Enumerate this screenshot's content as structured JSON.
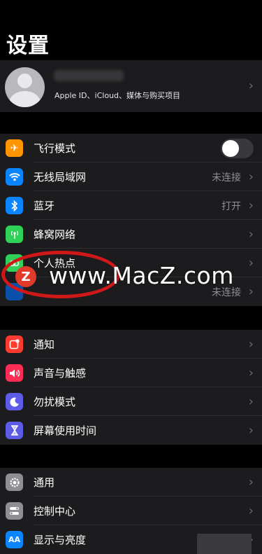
{
  "header": {
    "title": "设置"
  },
  "profile": {
    "subtitle": "Apple ID、iCloud、媒体与购买项目"
  },
  "group1": [
    {
      "label": "飞行模式",
      "icon": "airplane-icon",
      "color": "#ff9500",
      "toggle": false
    },
    {
      "label": "无线局域网",
      "icon": "wifi-icon",
      "color": "#0a84ff",
      "value": "未连接"
    },
    {
      "label": "蓝牙",
      "icon": "bluetooth-icon",
      "color": "#0a84ff",
      "value": "打开"
    },
    {
      "label": "蜂窝网络",
      "icon": "cellular-icon",
      "color": "#30d158"
    },
    {
      "label": "个人热点",
      "icon": "hotspot-icon",
      "color": "#30d158"
    },
    {
      "label": "",
      "icon": "vpn-icon",
      "color": "#0a4fa8",
      "value": "未连接"
    }
  ],
  "group2": [
    {
      "label": "通知",
      "icon": "notifications-icon",
      "color": "#ff3b30"
    },
    {
      "label": "声音与触感",
      "icon": "sounds-icon",
      "color": "#ff2d55"
    },
    {
      "label": "勿扰模式",
      "icon": "moon-icon",
      "color": "#5e5ce6"
    },
    {
      "label": "屏幕使用时间",
      "icon": "hourglass-icon",
      "color": "#5e5ce6"
    }
  ],
  "group3": [
    {
      "label": "通用",
      "icon": "gear-icon",
      "color": "#8e8e93"
    },
    {
      "label": "控制中心",
      "icon": "control-center-icon",
      "color": "#8e8e93"
    },
    {
      "label": "显示与亮度",
      "icon": "display-icon",
      "color": "#0a84ff"
    }
  ],
  "watermark": {
    "logo": "Z",
    "text": "www.MacZ.com"
  }
}
